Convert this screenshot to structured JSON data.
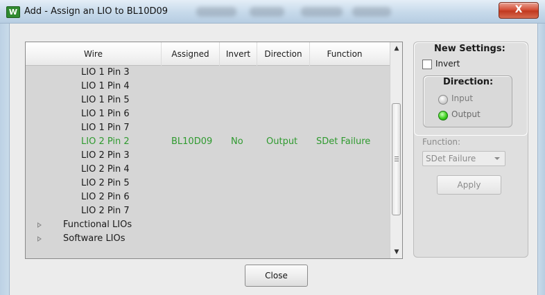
{
  "window": {
    "title": "Add - Assign an LIO to BL10D09",
    "app_icon_glyph": "W",
    "close_glyph": "X",
    "close_color": "#c1391f"
  },
  "list": {
    "columns": [
      "Wire",
      "Assigned",
      "Invert",
      "Direction",
      "Function"
    ],
    "rows": [
      {
        "wire": "LIO 1 Pin 3",
        "assigned": "",
        "invert": "",
        "direction": "",
        "function": ""
      },
      {
        "wire": "LIO 1 Pin 4",
        "assigned": "",
        "invert": "",
        "direction": "",
        "function": ""
      },
      {
        "wire": "LIO 1 Pin 5",
        "assigned": "",
        "invert": "",
        "direction": "",
        "function": ""
      },
      {
        "wire": "LIO 1 Pin 6",
        "assigned": "",
        "invert": "",
        "direction": "",
        "function": ""
      },
      {
        "wire": "LIO 1 Pin 7",
        "assigned": "",
        "invert": "",
        "direction": "",
        "function": ""
      },
      {
        "wire": "LIO 2 Pin 2",
        "assigned": "BL10D09",
        "invert": "No",
        "direction": "Output",
        "function": "SDet Failure",
        "highlighted": true
      },
      {
        "wire": "LIO 2 Pin 3",
        "assigned": "",
        "invert": "",
        "direction": "",
        "function": ""
      },
      {
        "wire": "LIO 2 Pin 4",
        "assigned": "",
        "invert": "",
        "direction": "",
        "function": ""
      },
      {
        "wire": "LIO 2 Pin 5",
        "assigned": "",
        "invert": "",
        "direction": "",
        "function": ""
      },
      {
        "wire": "LIO 2 Pin 6",
        "assigned": "",
        "invert": "",
        "direction": "",
        "function": ""
      },
      {
        "wire": "LIO 2 Pin 7",
        "assigned": "",
        "invert": "",
        "direction": "",
        "function": ""
      }
    ],
    "groups": [
      "Functional LIOs",
      "Software LIOs"
    ],
    "highlight_color": "#2f9a2f",
    "scroll_up_glyph": "▲",
    "scroll_down_glyph": "▼"
  },
  "settings": {
    "title": "New Settings:",
    "invert_label": "Invert",
    "invert_checked": false,
    "direction_title": "Direction:",
    "input_label": "Input",
    "output_label": "Output",
    "selected_direction": "Output",
    "function_label": "Function:",
    "function_value": "SDet Failure",
    "apply_label": "Apply"
  },
  "footer": {
    "close_label": "Close"
  }
}
